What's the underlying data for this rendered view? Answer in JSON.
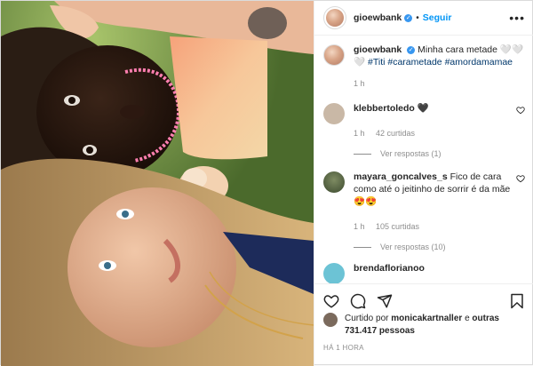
{
  "post": {
    "author": "gioewbank",
    "follow_label": "Seguir",
    "separator": "•",
    "more_label": "•••"
  },
  "caption": {
    "username": "gioewbank",
    "text_lead": "Minha cara metade ",
    "emoji": "🤍🤍🤍",
    "tags": "#Titi #carametade #amordamamae",
    "time": "1 h"
  },
  "comments": [
    {
      "username": "klebbertoledo",
      "text": "🖤",
      "time": "1 h",
      "likes": "42 curtidas",
      "replies": "Ver respostas (1)",
      "avatar_color": "#c9b8a6"
    },
    {
      "username": "mayara_goncalves_s",
      "text": "Fico de cara como até o jeitinho de sorrir é da mãe 😍😍",
      "time": "1 h",
      "likes": "105 curtidas",
      "replies": "Ver respostas (10)",
      "avatar_color": "#4d5e3e"
    },
    {
      "username": "brendaflorianoo",
      "text": "",
      "time": "",
      "likes": "",
      "replies": "",
      "avatar_color": "#6cc3d5"
    }
  ],
  "likes": {
    "prefix": "Curtido por ",
    "user": "monicakartnaller",
    "mid": " e ",
    "others": "outras 731.417 pessoas"
  },
  "timestamp": "HÁ 1 HORA",
  "icons": {
    "like": "heart-icon",
    "comment": "comment-icon",
    "share": "share-icon",
    "save": "bookmark-icon"
  },
  "colors": {
    "accent": "#0095f6",
    "verified": "#3897f0",
    "text": "#262626",
    "muted": "#8e8e8e"
  }
}
